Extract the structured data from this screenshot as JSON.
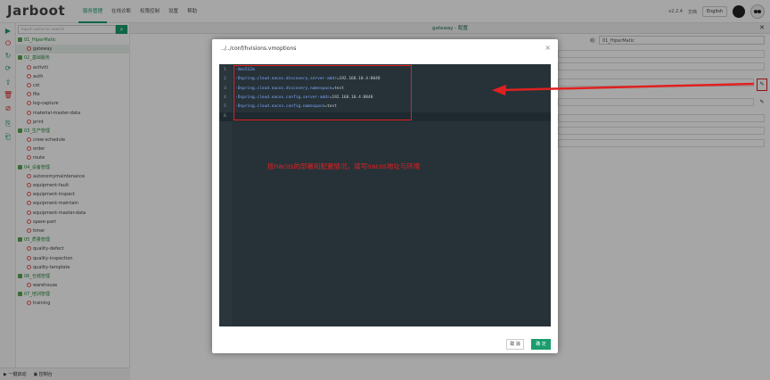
{
  "app": {
    "logo": "Jarboot",
    "version": "v2.2.4",
    "lang_zh": "文档",
    "lang_btn": "English"
  },
  "menu": [
    "服务管理",
    "在线诊断",
    "权限控制",
    "设置",
    "帮助"
  ],
  "sidebar": {
    "search_placeholder": "Input name to search",
    "search_icon": "search-icon",
    "tree": [
      {
        "type": "group",
        "label": "01_HiperMatic"
      },
      {
        "type": "item",
        "label": "gateway",
        "selected": true
      },
      {
        "type": "group",
        "label": "02_基础服务"
      },
      {
        "type": "item",
        "label": "activiti"
      },
      {
        "type": "item",
        "label": "auth"
      },
      {
        "type": "item",
        "label": "cst"
      },
      {
        "type": "item",
        "label": "file"
      },
      {
        "type": "item",
        "label": "log-capture"
      },
      {
        "type": "item",
        "label": "material-master-data"
      },
      {
        "type": "item",
        "label": "print"
      },
      {
        "type": "group",
        "label": "03_生产管理"
      },
      {
        "type": "item",
        "label": "crew-schedule"
      },
      {
        "type": "item",
        "label": "order"
      },
      {
        "type": "item",
        "label": "route"
      },
      {
        "type": "group",
        "label": "04_设备管理"
      },
      {
        "type": "item",
        "label": "autonomymaintenance"
      },
      {
        "type": "item",
        "label": "equipment-fault"
      },
      {
        "type": "item",
        "label": "equipment-inspect"
      },
      {
        "type": "item",
        "label": "equipment-maintain"
      },
      {
        "type": "item",
        "label": "equipment-master-data"
      },
      {
        "type": "item",
        "label": "spare-part"
      },
      {
        "type": "item",
        "label": "timer"
      },
      {
        "type": "group",
        "label": "05_质量管理"
      },
      {
        "type": "item",
        "label": "quality-defect"
      },
      {
        "type": "item",
        "label": "quality-inspection"
      },
      {
        "type": "item",
        "label": "quality-template"
      },
      {
        "type": "group",
        "label": "06_仓储管理"
      },
      {
        "type": "item",
        "label": "warehouse"
      },
      {
        "type": "group",
        "label": "07_培训管理"
      },
      {
        "type": "item",
        "label": "training"
      }
    ],
    "bottom": [
      "一键启动",
      "控制台"
    ]
  },
  "main": {
    "title": "gateway - 配置",
    "group_label": "组:",
    "group_value": "01_HiperMatic"
  },
  "modal": {
    "title": "../../conf/hvisions.vmoptions",
    "lines": [
      {
        "n": "1",
        "key": "-Xmx512m",
        "val": ""
      },
      {
        "n": "2",
        "key": "-Dspring.cloud.nacos.discovery.server-addr",
        "val": "=192.168.10.4:8848"
      },
      {
        "n": "3",
        "key": "-Dspring.cloud.nacos.discovery.namespace",
        "val": "=test"
      },
      {
        "n": "4",
        "key": "-Dspring.cloud.nacos.config.server-addr",
        "val": "=192.168.10.4:8848"
      },
      {
        "n": "5",
        "key": "-Dspring.cloud.nacos.config.namespace",
        "val": "=test"
      },
      {
        "n": "6",
        "key": "",
        "val": ""
      }
    ],
    "annotation": "按nacos的部署和配置情况，填写nacos地址与环境",
    "cancel": "取 消",
    "ok": "确 定"
  },
  "colors": {
    "accent": "#1a9c6c",
    "annotation": "#e02020"
  }
}
